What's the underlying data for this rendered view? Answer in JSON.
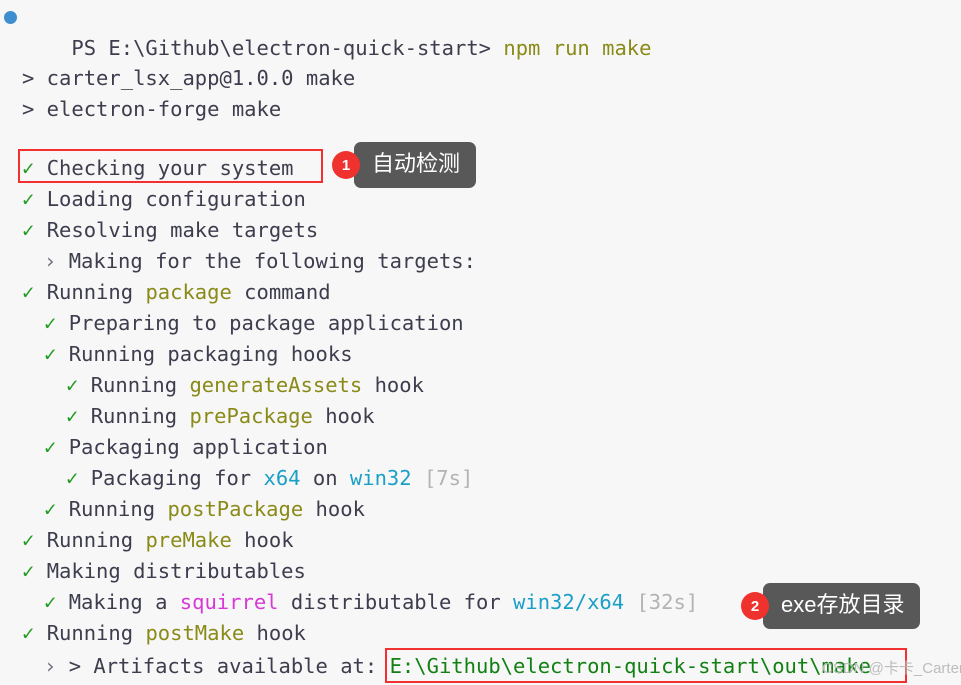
{
  "terminal": {
    "background_color": "#f7f7f7",
    "text_color": "#3d3d4e",
    "prompt_bullet_color": "#3e8ed0",
    "check_color": "#1f9b1f",
    "prompt": "PS E:\\Github\\electron-quick-start>",
    "command": "npm run make",
    "lines": {
      "l1_pkg": "> carter_lsx_app@1.0.0 make",
      "l2_forge": "> electron-forge make",
      "l3_check": "Checking your system",
      "l4_loading": "Loading configuration",
      "l5_resolving": "Resolving make targets",
      "l6_making_for": "Making for the following targets:",
      "l7_running_a": "Running ",
      "l7_running_key": "package",
      "l7_running_b": " command",
      "l8_preparing": "Preparing to package application",
      "l9_hooks": "Running packaging hooks",
      "l10_a": "Running ",
      "l10_key": "generateAssets",
      "l10_b": " hook",
      "l11_a": "Running ",
      "l11_key": "prePackage",
      "l11_b": " hook",
      "l12_packaging": "Packaging application",
      "l13_a": "Packaging for ",
      "l13_arch": "x64",
      "l13_b": " on ",
      "l13_platform": "win32",
      "l13_c": " ",
      "l13_time": "[7s]",
      "l14_a": "Running ",
      "l14_key": "postPackage",
      "l14_b": " hook",
      "l15_a": "Running ",
      "l15_key": "preMake",
      "l15_b": " hook",
      "l16_making_dist": "Making distributables",
      "l17_a": "Making a ",
      "l17_maker": "squirrel",
      "l17_b": " distributable for ",
      "l17_target": "win32/x64",
      "l17_c": " ",
      "l17_time": "[32s]",
      "l18_a": "Running ",
      "l18_key": "postMake",
      "l18_b": " hook",
      "l19_artifacts_label": "> Artifacts available at: ",
      "l19_artifacts_path": "E:\\Github\\electron-quick-start\\out\\make"
    },
    "glyphs": {
      "check": "✓",
      "chevron": "›"
    }
  },
  "annotations": {
    "badge_color": "#f0322f",
    "bubble_color": "#585858",
    "highlight_box_color": "#f2302f",
    "items": [
      {
        "number": "1",
        "text": "自动检测"
      },
      {
        "number": "2",
        "text": "exe存放目录"
      }
    ]
  },
  "watermark": {
    "text": "CSDN @卡卡_Carter"
  }
}
